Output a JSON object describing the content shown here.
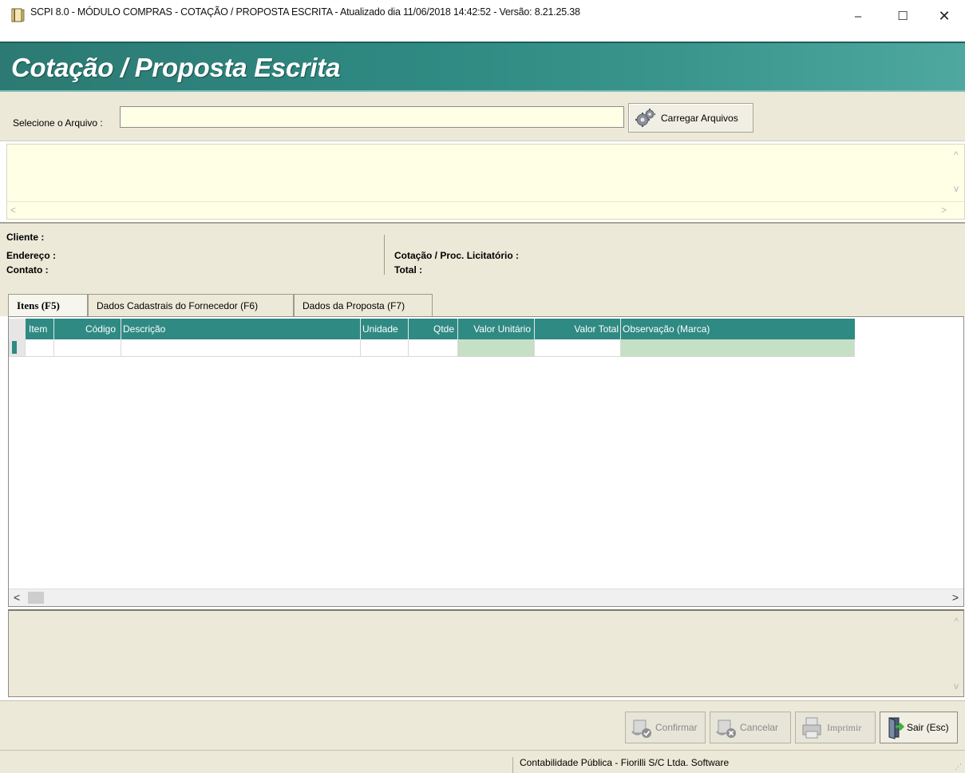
{
  "window": {
    "title": "SCPI 8.0 - MÓDULO COMPRAS - COTAÇÃO / PROPOSTA ESCRITA - Atualizado dia 11/06/2018 14:42:52 - Versão: 8.21.25.38",
    "minimize": "–",
    "maximize": "☐",
    "close": "✕"
  },
  "banner": {
    "title": "Cotação / Proposta Escrita"
  },
  "file": {
    "label": "Selecione o Arquivo :",
    "value": "",
    "load_button": "Carregar Arquivos"
  },
  "memo": {
    "scroll_up": "^",
    "scroll_down": "v",
    "scroll_left": "<",
    "scroll_right": ">"
  },
  "info": {
    "cliente": "Cliente :",
    "endereco": "Endereço :",
    "contato": "Contato :",
    "cotacao": "Cotação / Proc. Licitatório :",
    "total": "Total :"
  },
  "tabs": [
    {
      "label": "Itens (F5)",
      "active": true
    },
    {
      "label": "Dados Cadastrais do Fornecedor (F6)",
      "active": false
    },
    {
      "label": "Dados da Proposta (F7)",
      "active": false
    }
  ],
  "grid": {
    "columns": [
      "Item",
      "Código",
      "Descrição",
      "Unidade",
      "Qtde",
      "Valor Unitário",
      "Valor Total",
      "Observação (Marca)"
    ],
    "scroll_left": "<",
    "scroll_right": ">"
  },
  "lower_memo": {
    "scroll_up": "^",
    "scroll_down": "v"
  },
  "buttons": {
    "confirm": "Confirmar",
    "cancel": "Cancelar",
    "print": "Imprimir",
    "exit": "Sair (Esc)"
  },
  "status": {
    "text": "Contabilidade Pública - Fiorilli S/C Ltda. Software"
  },
  "colors": {
    "banner": "#2f8a83",
    "memo": "#ffffe6",
    "panel": "#ece9d8",
    "grid_edit": "#c5e0c4"
  }
}
